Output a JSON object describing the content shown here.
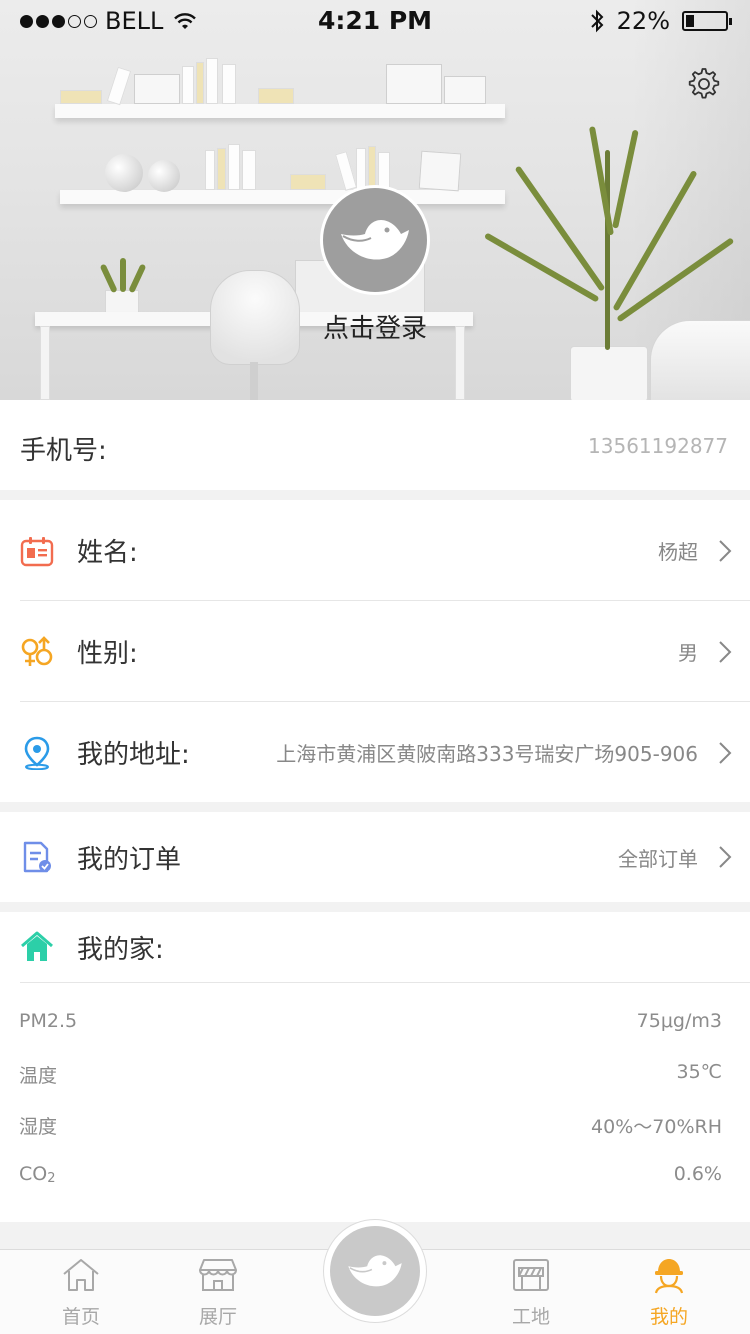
{
  "status_bar": {
    "carrier": "BELL",
    "time": "4:21 PM",
    "battery": "22%",
    "battery_level": 0.22
  },
  "header": {
    "login_text": "点击登录"
  },
  "phone": {
    "label": "手机号:",
    "value": "13561192877"
  },
  "profile": [
    {
      "label": "姓名:",
      "value": "杨超",
      "icon": "id-card-icon",
      "color": "#f26c4f"
    },
    {
      "label": "性别:",
      "value": "男",
      "icon": "gender-icon",
      "color": "#f5a623"
    },
    {
      "label": "我的地址:",
      "value": "上海市黄浦区黄陂南路333号瑞安广场905-906",
      "icon": "location-pin-icon",
      "color": "#2b9be8"
    }
  ],
  "orders": {
    "label": "我的订单",
    "value": "全部订单",
    "icon": "order-document-icon",
    "color": "#6f8ee8"
  },
  "home": {
    "label": "我的家:",
    "icon": "house-icon",
    "color": "#2ccfa8",
    "metrics": [
      {
        "key": "PM2.5",
        "value": "75μg/m3"
      },
      {
        "key": "温度",
        "value": "35℃"
      },
      {
        "key": "湿度",
        "value": "40%～70%RH"
      },
      {
        "key_main": "CO",
        "key_sub": "2",
        "value": "0.6%"
      }
    ]
  },
  "tabbar": {
    "tabs": [
      {
        "label": "首页",
        "icon": "home-icon"
      },
      {
        "label": "展厅",
        "icon": "storefront-icon"
      },
      {
        "label": "工地",
        "icon": "construction-icon"
      },
      {
        "label": "我的",
        "icon": "worker-helmet-icon"
      }
    ],
    "active_index": 3,
    "active_color": "#f5a623",
    "inactive_color": "#a8a8a8"
  }
}
